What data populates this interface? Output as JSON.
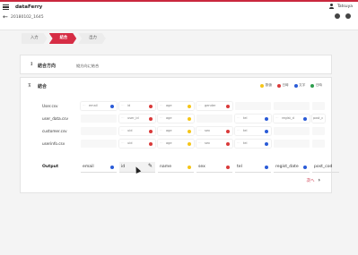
{
  "app": {
    "title": "dataFerry",
    "user": "Tatsuya"
  },
  "subbar": {
    "back_icon": "back-arrow",
    "crumb": "20180102_1645"
  },
  "steps": [
    {
      "label": "入力"
    },
    {
      "label": "結合"
    },
    {
      "label": "出力"
    }
  ],
  "card1": {
    "title": "結合方向",
    "value": "縦方向に結合"
  },
  "card2": {
    "title": "結合",
    "legend": [
      {
        "label": "数値",
        "color": "#f5c518"
      },
      {
        "label": "日時",
        "color": "#d93a3a"
      },
      {
        "label": "文字",
        "color": "#2a5bd7"
      },
      {
        "label": "日時",
        "color": "#2e9d4d"
      }
    ],
    "rows": [
      {
        "label": "User.csv",
        "cells": [
          "email",
          "id",
          "age",
          "gender",
          "",
          "",
          ""
        ]
      },
      {
        "label": "user_data.csv",
        "cells": [
          "",
          "user_id",
          "age",
          "",
          "tel",
          "regist_d",
          "post_c"
        ]
      },
      {
        "label": "customer.csv",
        "cells": [
          "",
          "uid",
          "age",
          "sex",
          "tel",
          "",
          ""
        ]
      },
      {
        "label": "userinfo.csv",
        "cells": [
          "",
          "uid",
          "age",
          "sex",
          "tel",
          "",
          ""
        ]
      }
    ],
    "output": {
      "label": "Output",
      "cells": [
        "email",
        "id",
        "name",
        "sex",
        "tel",
        "regist_date",
        "post_cod"
      ]
    },
    "next": "次へ"
  },
  "colors": {
    "accent": "#c9283e",
    "yellow": "#f5c518",
    "red": "#d93a3a",
    "blue": "#2a5bd7"
  }
}
